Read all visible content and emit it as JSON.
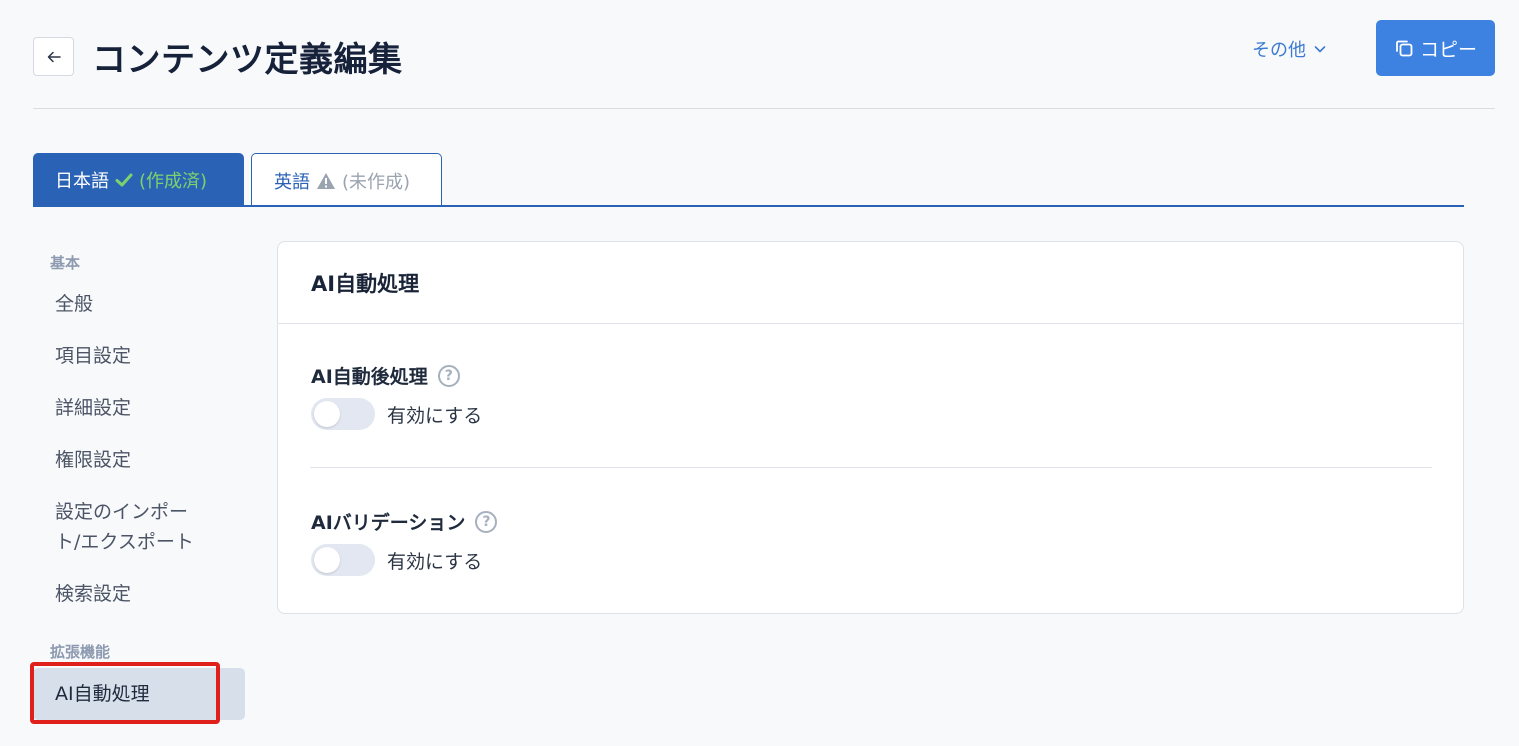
{
  "header": {
    "title": "コンテンツ定義編集",
    "more_label": "その他",
    "copy_label": "コピー"
  },
  "tabs": [
    {
      "label": "日本語",
      "status": "(作成済)",
      "active": true
    },
    {
      "label": "英語",
      "status": "(未作成)",
      "active": false
    }
  ],
  "sidebar": {
    "groups": [
      {
        "title": "基本",
        "items": [
          "全般",
          "項目設定",
          "詳細設定",
          "権限設定",
          "設定のインポート/エクスポート",
          "検索設定"
        ]
      },
      {
        "title": "拡張機能",
        "items": [
          "AI自動処理"
        ]
      }
    ],
    "import_export_line1": "設定のインポー",
    "import_export_line2": "ト/エクスポート",
    "active_item": "AI自動処理"
  },
  "card": {
    "title": "AI自動処理",
    "settings": [
      {
        "label": "AI自動後処理",
        "toggle_label": "有効にする",
        "enabled": false
      },
      {
        "label": "AIバリデーション",
        "toggle_label": "有効にする",
        "enabled": false
      }
    ]
  },
  "colors": {
    "primary": "#3d82e0",
    "tab_active": "#2a63b6",
    "ok_check": "#7cd36b",
    "highlight": "#e0201b"
  },
  "icons": {
    "back": "arrow-left-icon",
    "more": "chevron-down-icon",
    "copy": "copy-icon",
    "ok": "check-icon",
    "warn": "warning-icon",
    "help": "help-icon"
  }
}
